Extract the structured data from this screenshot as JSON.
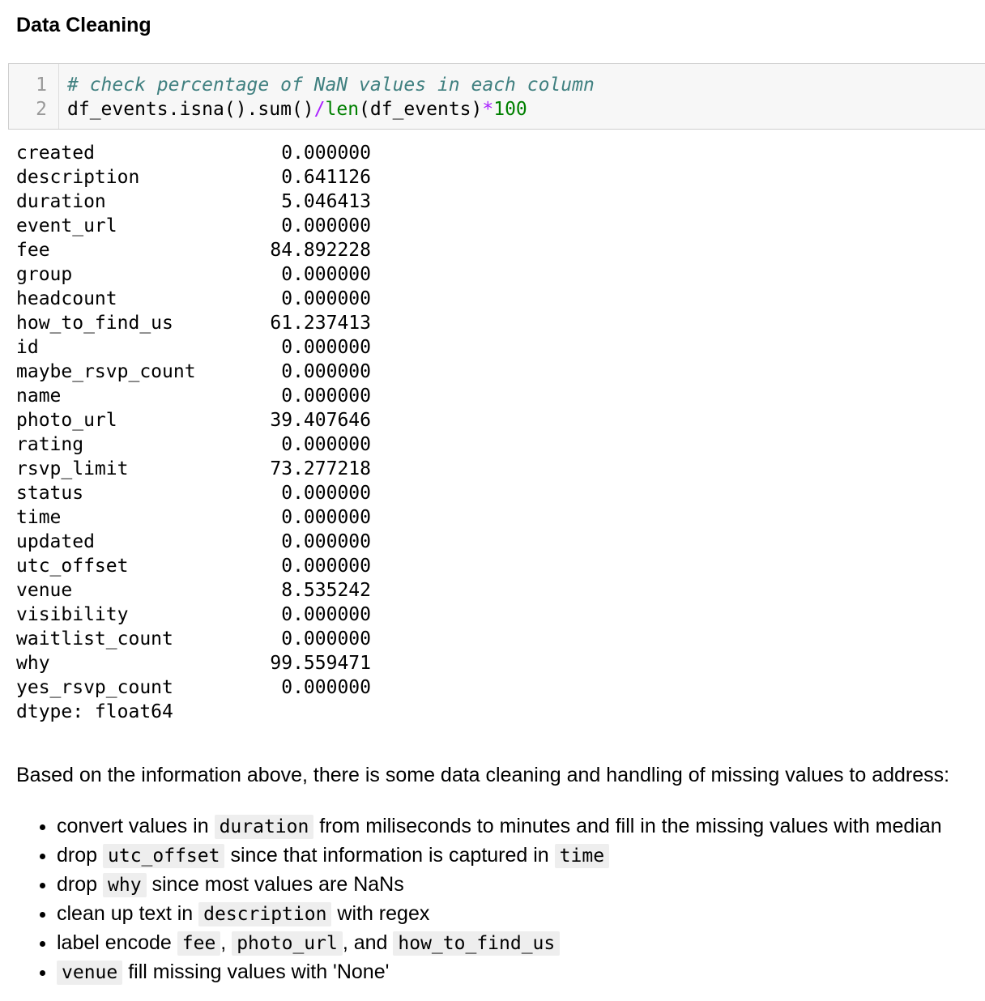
{
  "heading": "Data Cleaning",
  "code_cell": {
    "line_numbers": [
      "1",
      "2"
    ],
    "line1_comment": "# check percentage of NaN values in each column",
    "line2": {
      "part1": "df_events.isna().sum()",
      "op_div": "/",
      "builtin_len": "len",
      "part2": "(df_events)",
      "op_mul": "*",
      "number": "100"
    }
  },
  "output": {
    "rows": [
      {
        "name": "created",
        "value": "0.000000"
      },
      {
        "name": "description",
        "value": "0.641126"
      },
      {
        "name": "duration",
        "value": "5.046413"
      },
      {
        "name": "event_url",
        "value": "0.000000"
      },
      {
        "name": "fee",
        "value": "84.892228"
      },
      {
        "name": "group",
        "value": "0.000000"
      },
      {
        "name": "headcount",
        "value": "0.000000"
      },
      {
        "name": "how_to_find_us",
        "value": "61.237413"
      },
      {
        "name": "id",
        "value": "0.000000"
      },
      {
        "name": "maybe_rsvp_count",
        "value": "0.000000"
      },
      {
        "name": "name",
        "value": "0.000000"
      },
      {
        "name": "photo_url",
        "value": "39.407646"
      },
      {
        "name": "rating",
        "value": "0.000000"
      },
      {
        "name": "rsvp_limit",
        "value": "73.277218"
      },
      {
        "name": "status",
        "value": "0.000000"
      },
      {
        "name": "time",
        "value": "0.000000"
      },
      {
        "name": "updated",
        "value": "0.000000"
      },
      {
        "name": "utc_offset",
        "value": "0.000000"
      },
      {
        "name": "venue",
        "value": "8.535242"
      },
      {
        "name": "visibility",
        "value": "0.000000"
      },
      {
        "name": "waitlist_count",
        "value": "0.000000"
      },
      {
        "name": "why",
        "value": "99.559471"
      },
      {
        "name": "yes_rsvp_count",
        "value": "0.000000"
      }
    ],
    "dtype": "dtype: float64"
  },
  "intro": "Based on the information above, there is some data cleaning and handling of missing values to address:",
  "bullets": {
    "b1": {
      "t1": "convert values in",
      "c1": "duration",
      "t2": "from miliseconds to minutes and fill in the missing values with median"
    },
    "b2": {
      "t1": "drop",
      "c1": "utc_offset",
      "t2": "since that information is captured in",
      "c2": "time"
    },
    "b3": {
      "t1": "drop",
      "c1": "why",
      "t2": "since most values are NaNs"
    },
    "b4": {
      "t1": "clean up text in",
      "c1": "description",
      "t2": "with regex"
    },
    "b5": {
      "t1": "label encode",
      "c1": "fee",
      "t2": ",",
      "c2": "photo_url",
      "t3": ", and",
      "c3": "how_to_find_us"
    },
    "b6": {
      "c1": "venue",
      "t1": "fill missing values with 'None'"
    }
  }
}
